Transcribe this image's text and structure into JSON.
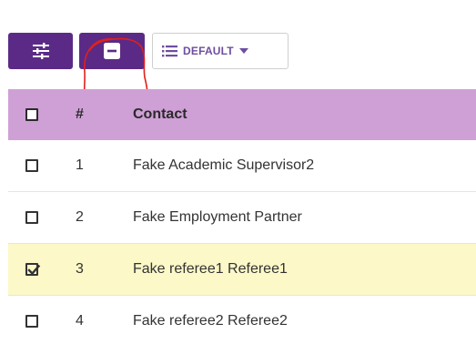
{
  "toolbar": {
    "filter_icon": "sliders-icon",
    "collapse_icon": "minus-box-icon",
    "view_icon": "list-icon",
    "view_label": "DEFAULT",
    "dropdown_icon": "caret-down-icon",
    "button_color": "#5b2a86",
    "view_label_color": "#6d4ea0"
  },
  "annotation": {
    "color": "#e0201b",
    "shape": "hand-drawn-circle"
  },
  "table": {
    "header_color": "#cfa0d6",
    "selected_color": "#fcf8c8",
    "columns": {
      "number": "#",
      "contact": "Contact"
    },
    "rows": [
      {
        "number": "1",
        "contact": "Fake Academic Supervisor2",
        "checked": false
      },
      {
        "number": "2",
        "contact": "Fake Employment Partner",
        "checked": false
      },
      {
        "number": "3",
        "contact": "Fake referee1 Referee1",
        "checked": true
      },
      {
        "number": "4",
        "contact": "Fake referee2 Referee2",
        "checked": false
      }
    ]
  }
}
